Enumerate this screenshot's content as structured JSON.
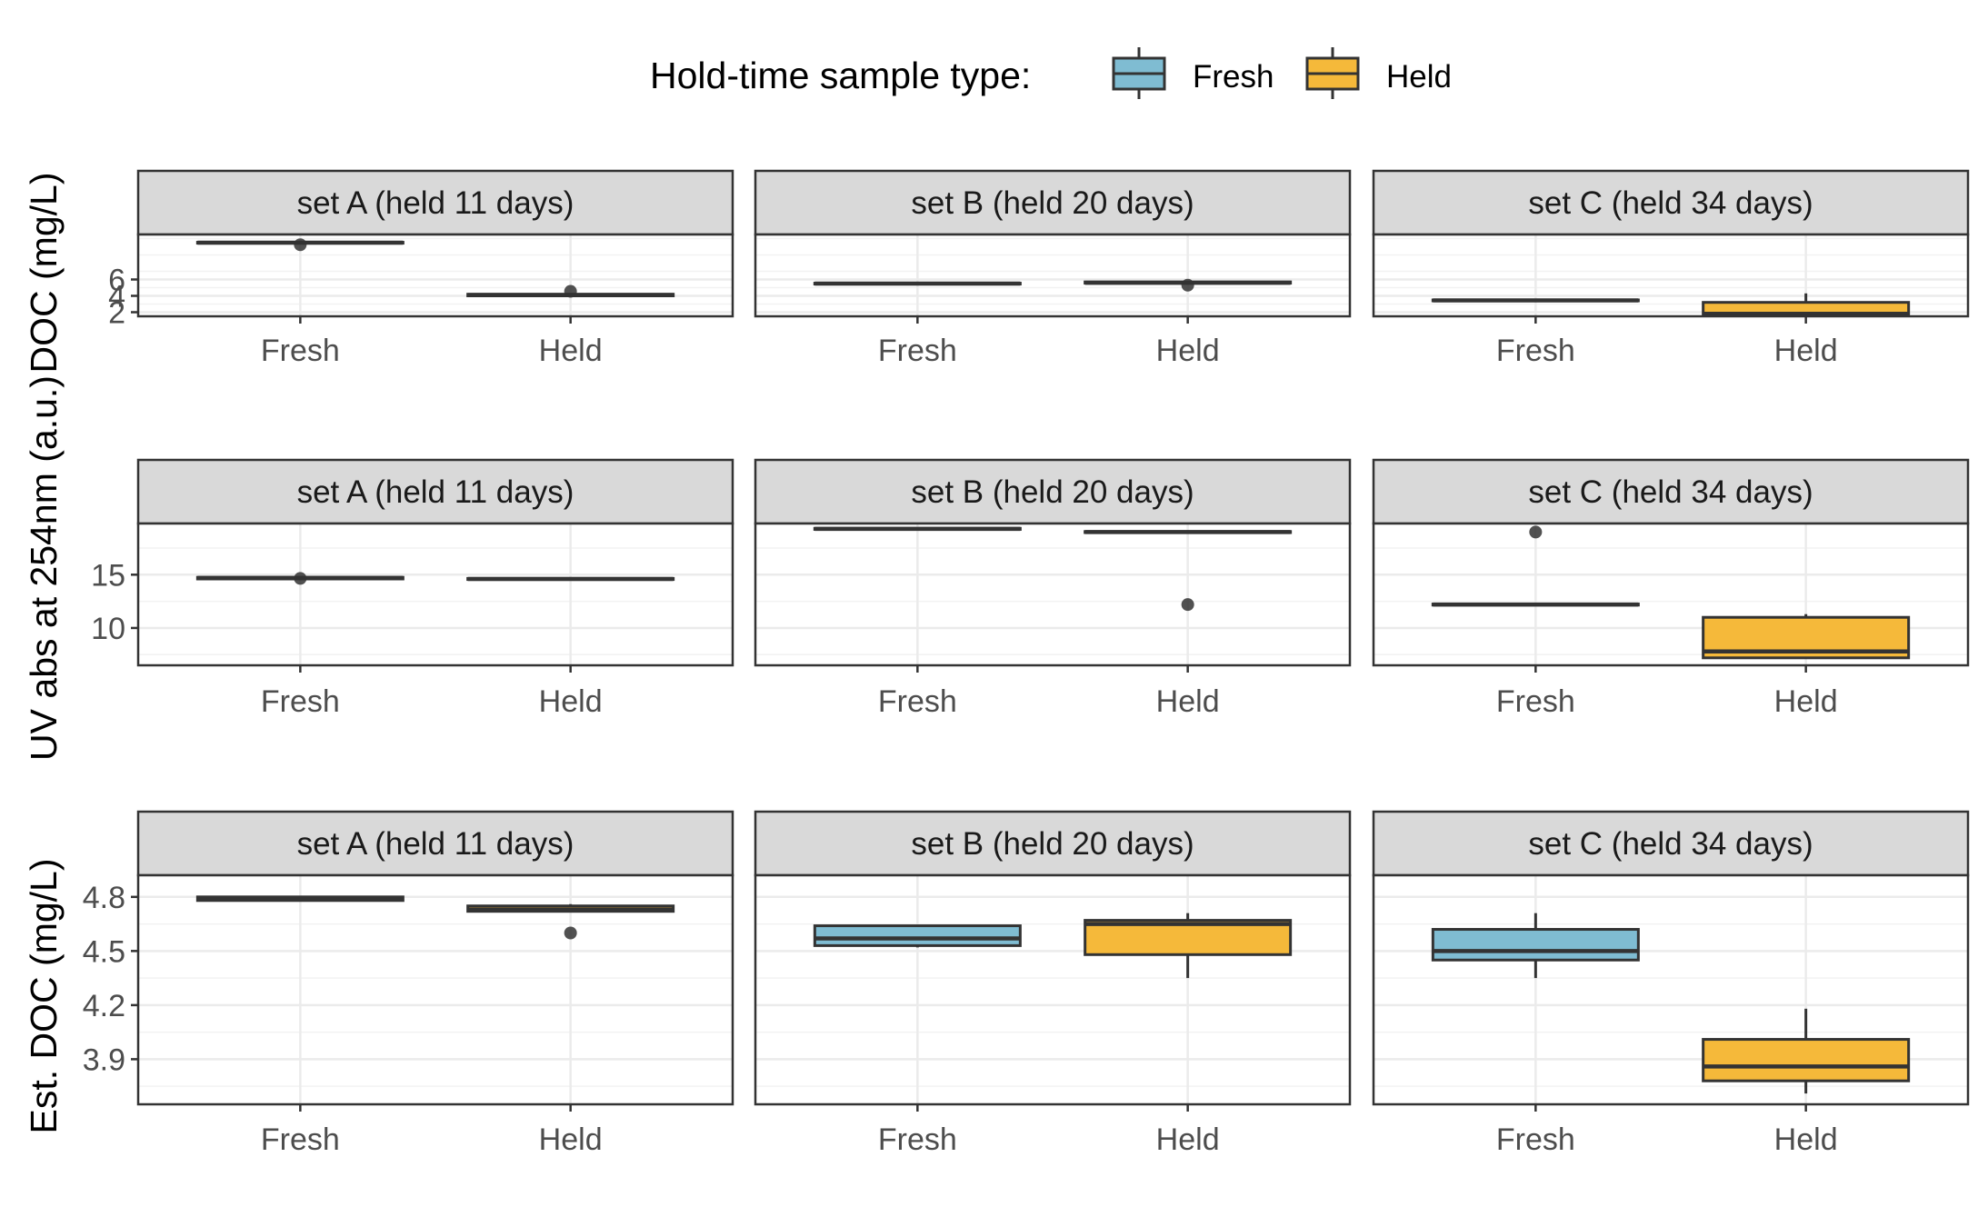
{
  "legend": {
    "title": "Hold-time sample type:",
    "items": [
      {
        "label": "Fresh",
        "color": "#7fbcd2"
      },
      {
        "label": "Held",
        "color": "#f5b93a"
      }
    ]
  },
  "y_labels": {
    "top_and_middle": "UV abs at 254nm (a.u.)",
    "top": "DOC (mg/L)",
    "bottom": "Est. DOC (mg/L)"
  },
  "chart_data": [
    {
      "type": "box",
      "row": 1,
      "ylim": [
        1.5,
        11.5
      ],
      "y_ticks": [
        2,
        4,
        6
      ],
      "panels": [
        {
          "strip": "set A (held 11 days)",
          "categories": [
            "Fresh",
            "Held"
          ],
          "boxes": [
            {
              "group": "Fresh",
              "whisker_low": 10.45,
              "q1": 10.45,
              "median": 10.5,
              "q3": 10.55,
              "whisker_high": 10.55,
              "outliers": [
                10.25
              ]
            },
            {
              "group": "Held",
              "whisker_low": 4.0,
              "q1": 4.0,
              "median": 4.1,
              "q3": 4.2,
              "whisker_high": 4.2,
              "outliers": [
                4.55
              ]
            }
          ]
        },
        {
          "strip": "set B (held 20 days)",
          "categories": [
            "Fresh",
            "Held"
          ],
          "boxes": [
            {
              "group": "Fresh",
              "whisker_low": 5.4,
              "q1": 5.45,
              "median": 5.5,
              "q3": 5.55,
              "whisker_high": 5.55,
              "outliers": []
            },
            {
              "group": "Held",
              "whisker_low": 5.5,
              "q1": 5.55,
              "median": 5.6,
              "q3": 5.7,
              "whisker_high": 5.7,
              "outliers": [
                5.3
              ]
            }
          ]
        },
        {
          "strip": "set C (held 34 days)",
          "categories": [
            "Fresh",
            "Held"
          ],
          "boxes": [
            {
              "group": "Fresh",
              "whisker_low": 3.4,
              "q1": 3.4,
              "median": 3.45,
              "q3": 3.5,
              "whisker_high": 3.5,
              "outliers": []
            },
            {
              "group": "Held",
              "whisker_low": 1.7,
              "q1": 1.7,
              "median": 1.8,
              "q3": 3.2,
              "whisker_high": 4.3,
              "outliers": []
            }
          ]
        }
      ]
    },
    {
      "type": "box",
      "row": 2,
      "ylim": [
        6.5,
        19.8
      ],
      "y_ticks": [
        10,
        15
      ],
      "panels": [
        {
          "strip": "set A (held 11 days)",
          "categories": [
            "Fresh",
            "Held"
          ],
          "boxes": [
            {
              "group": "Fresh",
              "whisker_low": 14.6,
              "q1": 14.6,
              "median": 14.7,
              "q3": 14.75,
              "whisker_high": 14.75,
              "outliers": [
                14.65
              ]
            },
            {
              "group": "Held",
              "whisker_low": 14.5,
              "q1": 14.55,
              "median": 14.6,
              "q3": 14.65,
              "whisker_high": 14.65,
              "outliers": []
            }
          ]
        },
        {
          "strip": "set B (held 20 days)",
          "categories": [
            "Fresh",
            "Held"
          ],
          "boxes": [
            {
              "group": "Fresh",
              "whisker_low": 19.2,
              "q1": 19.25,
              "median": 19.3,
              "q3": 19.35,
              "whisker_high": 19.35,
              "outliers": []
            },
            {
              "group": "Held",
              "whisker_low": 18.9,
              "q1": 18.95,
              "median": 19.0,
              "q3": 19.05,
              "whisker_high": 19.05,
              "outliers": [
                12.2
              ]
            }
          ]
        },
        {
          "strip": "set C (held 34 days)",
          "categories": [
            "Fresh",
            "Held"
          ],
          "boxes": [
            {
              "group": "Fresh",
              "whisker_low": 12.1,
              "q1": 12.15,
              "median": 12.2,
              "q3": 12.25,
              "whisker_high": 12.25,
              "outliers": [
                19.0
              ]
            },
            {
              "group": "Held",
              "whisker_low": 7.2,
              "q1": 7.2,
              "median": 7.8,
              "q3": 11.0,
              "whisker_high": 11.3,
              "outliers": []
            }
          ]
        }
      ]
    },
    {
      "type": "box",
      "row": 3,
      "ylim": [
        3.65,
        4.92
      ],
      "y_ticks": [
        3.9,
        4.2,
        4.5,
        4.8
      ],
      "panels": [
        {
          "strip": "set A (held 11 days)",
          "categories": [
            "Fresh",
            "Held"
          ],
          "boxes": [
            {
              "group": "Fresh",
              "whisker_low": 4.78,
              "q1": 4.78,
              "median": 4.79,
              "q3": 4.8,
              "whisker_high": 4.8,
              "outliers": []
            },
            {
              "group": "Held",
              "whisker_low": 4.72,
              "q1": 4.72,
              "median": 4.73,
              "q3": 4.75,
              "whisker_high": 4.76,
              "outliers": [
                4.6
              ]
            }
          ]
        },
        {
          "strip": "set B (held 20 days)",
          "categories": [
            "Fresh",
            "Held"
          ],
          "boxes": [
            {
              "group": "Fresh",
              "whisker_low": 4.52,
              "q1": 4.53,
              "median": 4.57,
              "q3": 4.64,
              "whisker_high": 4.64,
              "outliers": []
            },
            {
              "group": "Held",
              "whisker_low": 4.35,
              "q1": 4.48,
              "median": 4.65,
              "q3": 4.67,
              "whisker_high": 4.71,
              "outliers": []
            }
          ]
        },
        {
          "strip": "set C (held 34 days)",
          "categories": [
            "Fresh",
            "Held"
          ],
          "boxes": [
            {
              "group": "Fresh",
              "whisker_low": 4.35,
              "q1": 4.45,
              "median": 4.5,
              "q3": 4.62,
              "whisker_high": 4.71,
              "outliers": []
            },
            {
              "group": "Held",
              "whisker_low": 3.71,
              "q1": 3.78,
              "median": 3.86,
              "q3": 4.01,
              "whisker_high": 4.18,
              "outliers": []
            }
          ]
        }
      ]
    }
  ]
}
